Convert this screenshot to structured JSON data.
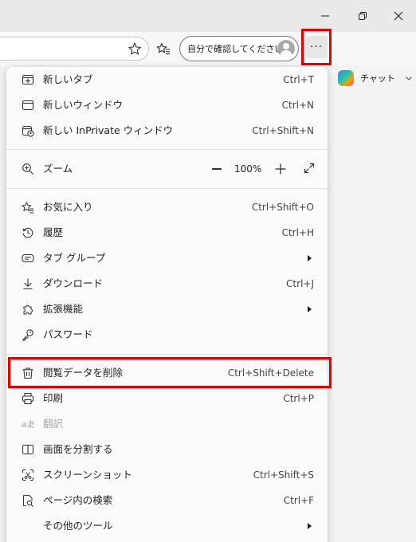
{
  "toolbar": {
    "profile_label": "自分で確認してください",
    "copilot_label": "チャット"
  },
  "zoom": {
    "label": "ズーム",
    "value": "100%"
  },
  "menu": {
    "new_tab": {
      "label": "新しいタブ",
      "shortcut": "Ctrl+T"
    },
    "new_window": {
      "label": "新しいウィンドウ",
      "shortcut": "Ctrl+N"
    },
    "new_inprivate": {
      "label": "新しい InPrivate ウィンドウ",
      "shortcut": "Ctrl+Shift+N"
    },
    "favorites": {
      "label": "お気に入り",
      "shortcut": "Ctrl+Shift+O"
    },
    "history": {
      "label": "履歴",
      "shortcut": "Ctrl+H"
    },
    "tab_groups": {
      "label": "タブ グループ"
    },
    "downloads": {
      "label": "ダウンロード",
      "shortcut": "Ctrl+J"
    },
    "extensions": {
      "label": "拡張機能"
    },
    "passwords": {
      "label": "パスワード"
    },
    "clear_data": {
      "label": "閲覧データを削除",
      "shortcut": "Ctrl+Shift+Delete"
    },
    "print": {
      "label": "印刷",
      "shortcut": "Ctrl+P"
    },
    "translate": {
      "label": "翻訳"
    },
    "split_screen": {
      "label": "画面を分割する"
    },
    "screenshot": {
      "label": "スクリーンショット",
      "shortcut": "Ctrl+Shift+S"
    },
    "find": {
      "label": "ページ内の検索",
      "shortcut": "Ctrl+F"
    },
    "more_tools": {
      "label": "その他のツール"
    }
  },
  "colors": {
    "highlight": "#e60000",
    "menu_bg": "#fbfbfb"
  }
}
